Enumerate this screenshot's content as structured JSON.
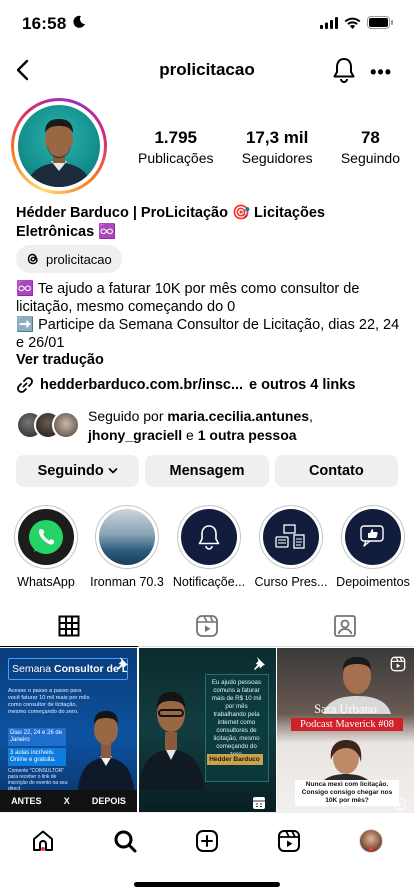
{
  "status": {
    "time": "16:58"
  },
  "header": {
    "username": "prolicitacao",
    "more": "•••"
  },
  "stats": [
    {
      "num": "1.795",
      "label": "Publicações"
    },
    {
      "num": "17,3 mil",
      "label": "Seguidores"
    },
    {
      "num": "78",
      "label": "Seguindo"
    }
  ],
  "profile": {
    "fullname": "Hédder Barduco | ProLicitação 🎯 Licitações Eletrônicas ♾️",
    "threads": "prolicitacao",
    "bio_line1": "♾️ Te ajudo a faturar 10K por mês como consultor de licitação, mesmo começando do 0",
    "bio_line2": "➡️ Participe da Semana Consultor de Licitação, dias 22, 24 e 26/01",
    "translate": "Ver tradução",
    "link": "hedderbarduco.com.br/insc...",
    "link_more": "e outros 4 links"
  },
  "followed": {
    "prefix": "Seguido por ",
    "user1": "maria.cecilia.antunes",
    "sep": ",",
    "user2": "jhony_graciell",
    "and": " e ",
    "others": "1 outra pessoa"
  },
  "buttons": {
    "following": "Seguindo",
    "message": "Mensagem",
    "contact": "Contato"
  },
  "highlights": [
    {
      "label": "WhatsApp",
      "icon": "whatsapp-icon"
    },
    {
      "label": "Ironman 70.3",
      "icon": "photo"
    },
    {
      "label": "Notificaçõe...",
      "icon": "bell-icon"
    },
    {
      "label": "Curso Pres...",
      "icon": "desk-icon"
    },
    {
      "label": "Depoimentos",
      "icon": "thumbs-up-icon"
    }
  ],
  "posts": {
    "p1_title_a": "Semana ",
    "p1_title_b": "Consultor de Licita",
    "p1_text": "Acesse o passo a passo para você faturar 10 mil reais por mês como consultor de licitação, mesmo começando do zero.",
    "p1_dates": "Dias 22, 24 e 26 de Janeiro",
    "p1_aulas": "3 aulas incríveis. Online e gratuita.",
    "p1_comment": "Comente \"CONSULTOR\" para receber o link de inscrição do evento na seu direct",
    "p1_bottom_a": "ANTES",
    "p1_bottom_x": "X",
    "p1_bottom_b": "DEPOIS",
    "p2_text": "Eu ajudo pessoas comuns a faturar mais de R$ 10 mil por mês trabalhando pela internet como consultores de licitação, mesmo começando do zero.",
    "p2_name": "Hédder Barduco",
    "p3_name": "Sara Urbano",
    "p3_title": "Podcast Maverick #08",
    "p3_caption": "Nunca mexi com licitação. Consigo consigo chegar nos 10K por mês?"
  },
  "colors": {
    "accent_blue": "#0095f6",
    "notification": "#ff3040",
    "chip_bg": "#efefef"
  }
}
